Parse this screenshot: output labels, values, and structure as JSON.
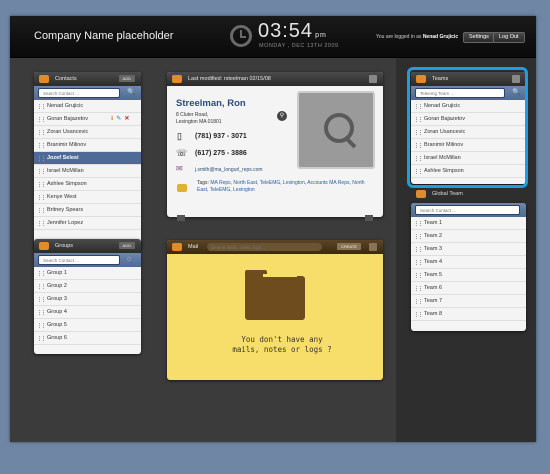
{
  "header": {
    "company": "Company Name placeholder",
    "time": "03:54",
    "ampm": "pm",
    "date": "MONDAY , DEC 13TH 2009",
    "logged_in_prefix": "You are logged in as",
    "user": "Nenad Grujicic",
    "settings_label": "Settings",
    "logout_label": "Log Out"
  },
  "contacts": {
    "title": "Contacts",
    "add_label": "ADD",
    "search_placeholder": "Search Contact ...",
    "items": [
      "Nenad Grujicic",
      "Goran Bajazetov",
      "Zoran Usancevic",
      "Branimir Milinov",
      "Jozef Selesi",
      "Israel McMillan",
      "Ashlee Simpson",
      "Kenye West",
      "Britney Spears",
      "Jennifer Lopez"
    ],
    "selected": "Jozef Selesi"
  },
  "groups": {
    "title": "Groups",
    "add_label": "ADD",
    "search_placeholder": "Search Contact ...",
    "items": [
      "Group 1",
      "Group 2",
      "Group 3",
      "Group 4",
      "Group 5",
      "Group 6"
    ]
  },
  "detail": {
    "last_modified": "Last modified: rsteelman 02/15/08",
    "name": "Streelman, Ron",
    "address1": "8 Cluter Road,",
    "address2": "Lexington MA 01801",
    "phone1": "(781) 937 - 3071",
    "phone2": "(617) 275 - 3886",
    "email": "j.smith@ma_longurl_reps.com",
    "tags_label": "Tags:",
    "tags": "MA Reps, North East, TeleEMG, Lexington, Accounts MA Reps, North East, TeleEMG, Lexington"
  },
  "mail": {
    "title": "Mail",
    "search_placeholder": "Search mails, notes, logs ...",
    "create_label": "CREATE",
    "empty_line1": "You don't have any",
    "empty_line2": "mails, notes or logs ?"
  },
  "teams": {
    "title": "Teams",
    "search_placeholder": "Teleemg Team ...",
    "items": [
      "Nenad Grujicic",
      "Goran Bajazetov",
      "Zoran Usancevic",
      "Branimir Milinov",
      "Israel McMillan",
      "Ashlee Simpson"
    ]
  },
  "global_team": {
    "title": "Global Team",
    "search_placeholder": "Search Contact ...",
    "items": [
      "Team 1",
      "Team 2",
      "Team 3",
      "Team 4",
      "Team 5",
      "Team 6",
      "Team 7",
      "Team 8"
    ]
  },
  "colors": {
    "accent": "#4e6a96",
    "highlight": "#1e9de0",
    "mail_bg": "#f7de6a"
  }
}
